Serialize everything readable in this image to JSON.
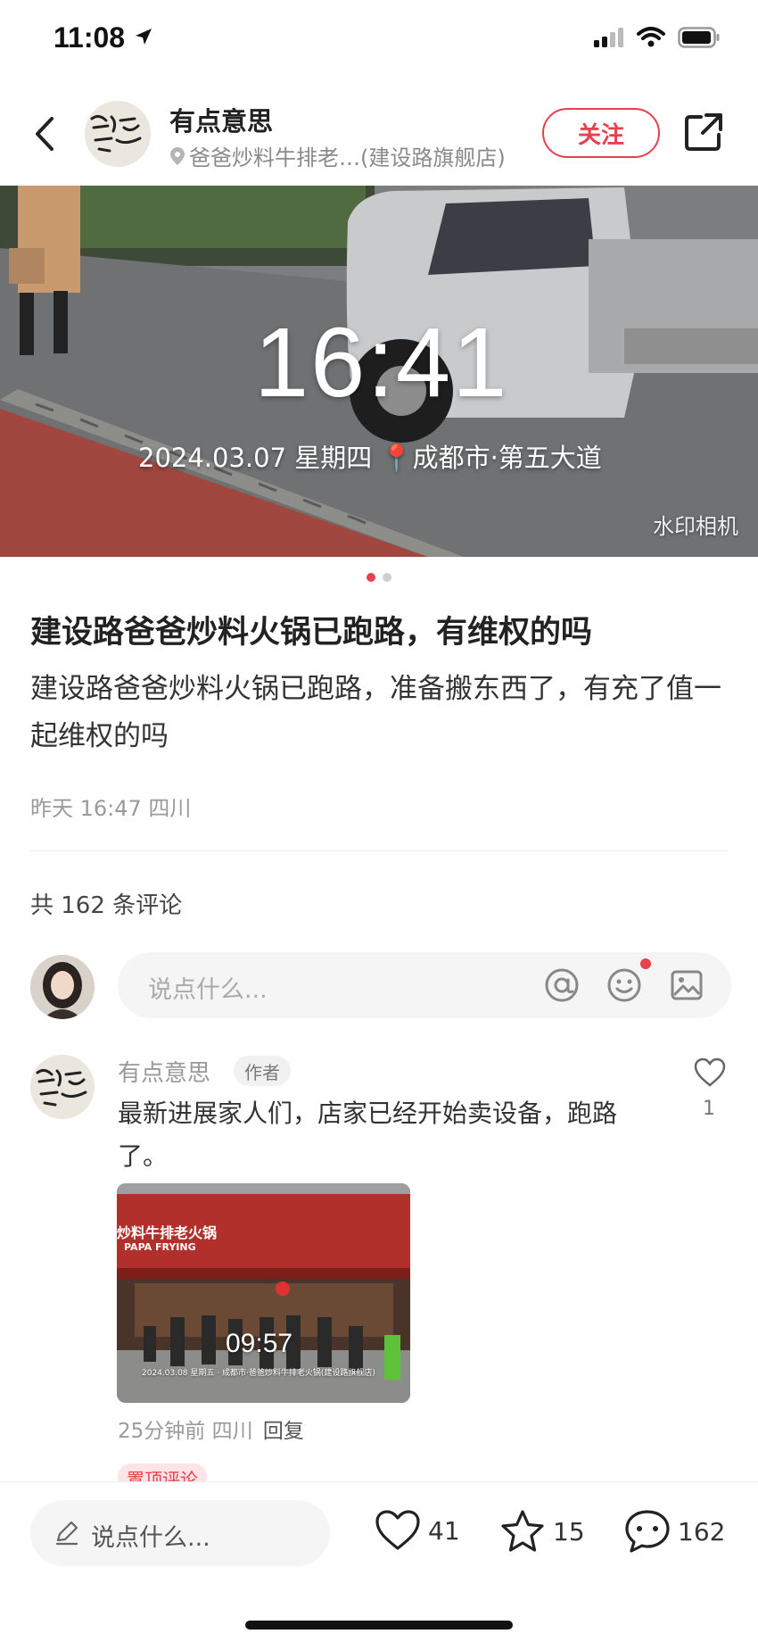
{
  "status_bar": {
    "time": "11:08"
  },
  "header": {
    "author_name": "有点意思",
    "location": "爸爸炒料牛排老…(建设路旗舰店)",
    "follow_label": "关注"
  },
  "photo": {
    "time": "16:41",
    "meta": "2024.03.07 星期四 📍成都市·第五大道",
    "watermark": "水印相机",
    "current_index": 1,
    "total": 2
  },
  "post": {
    "title": "建设路爸爸炒料火锅已跑路，有维权的吗",
    "body": "建设路爸爸炒料火锅已跑路，准备搬东西了，有充了值一起维权的吗",
    "meta": "昨天 16:47 四川"
  },
  "comments_section": {
    "count_label": "共 162 条评论",
    "input_placeholder": "说点什么..."
  },
  "comment": {
    "author": "有点意思",
    "badge": "作者",
    "text": "最新进展家人们，店家已经开始卖设备，跑路了。",
    "like_count": "1",
    "photo_time": "09:57",
    "photo_meta": "2024.03.08 星期五 · 成都市·爸爸炒料牛排老火锅(建设路旗舰店)",
    "photo_sign": "炒料牛排老火锅",
    "photo_sign_en": "PAPA FRYING",
    "time_ago": "25分钟前",
    "region": "四川",
    "reply_label": "回复",
    "pinned_label": "置顶评论"
  },
  "bottom_bar": {
    "input_placeholder": "说点什么...",
    "likes": "41",
    "stars": "15",
    "comments": "162"
  },
  "colors": {
    "accent": "#e8404f"
  }
}
